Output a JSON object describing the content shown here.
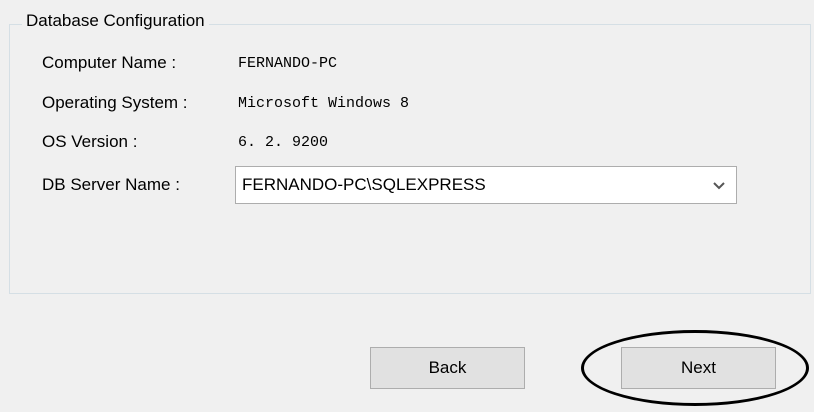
{
  "group": {
    "title": "Database Configuration"
  },
  "fields": {
    "computer_name": {
      "label": "Computer Name :",
      "value": "FERNANDO-PC"
    },
    "operating_system": {
      "label": "Operating System :",
      "value": "Microsoft Windows 8"
    },
    "os_version": {
      "label": "OS Version :",
      "value": "6. 2. 9200"
    },
    "db_server": {
      "label": "DB Server Name :",
      "value": "FERNANDO-PC\\SQLEXPRESS"
    }
  },
  "buttons": {
    "back": "Back",
    "next": "Next"
  },
  "icons": {
    "dropdown": "chevron-down-icon"
  }
}
